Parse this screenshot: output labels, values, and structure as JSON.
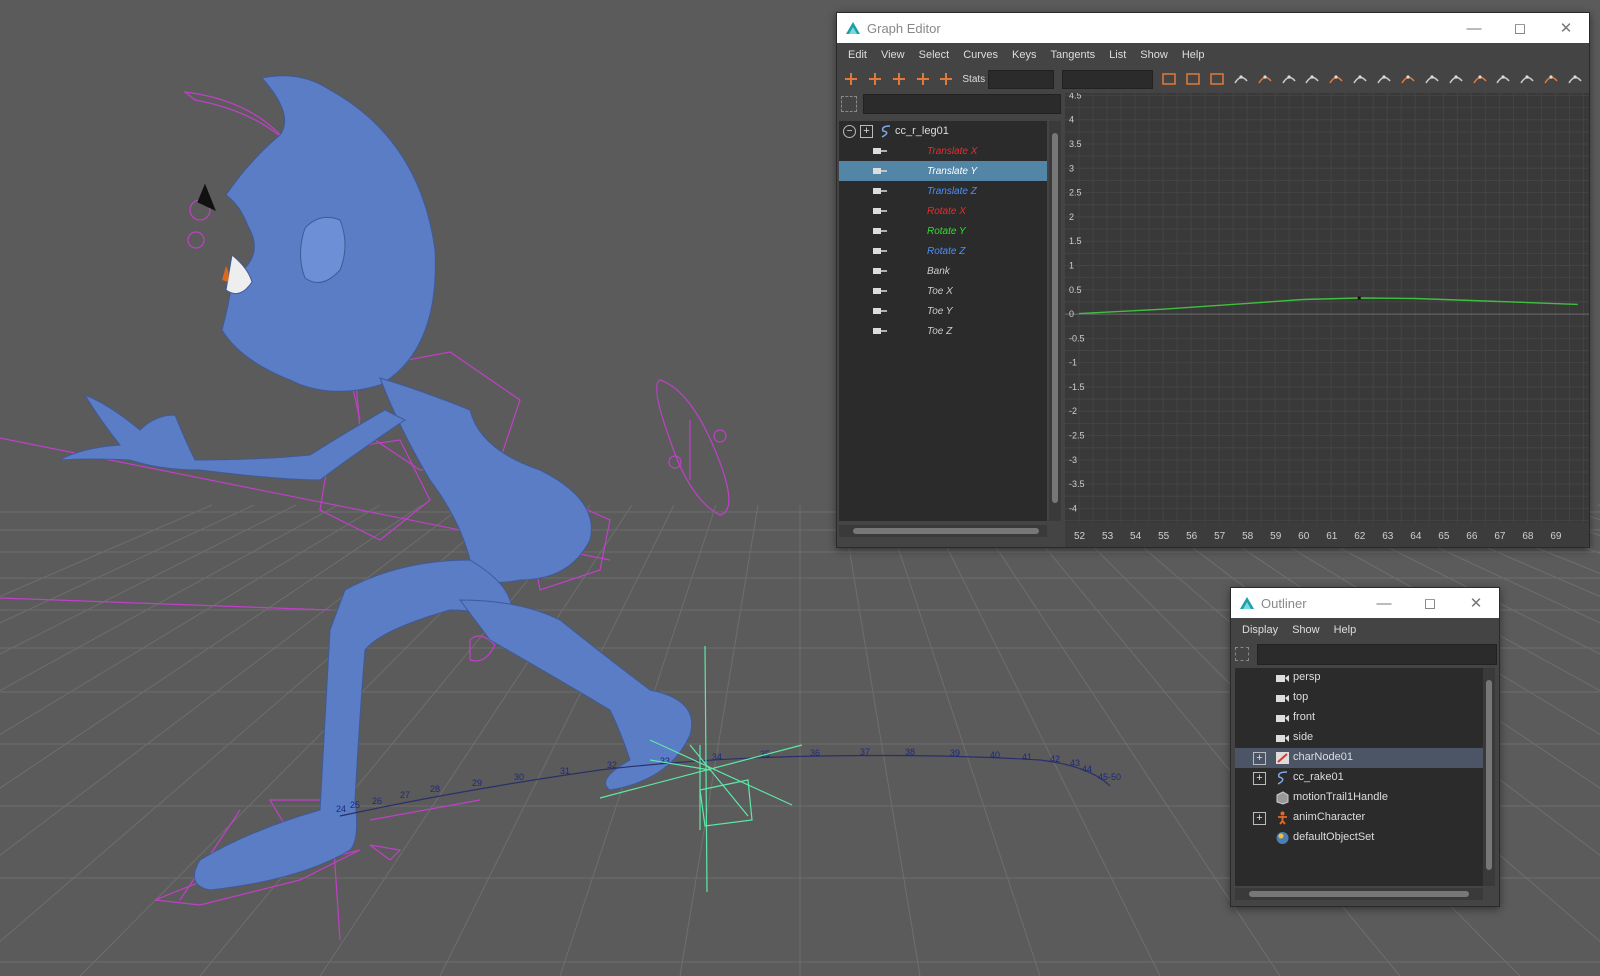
{
  "colors": {
    "viewport_bg": "#5b5b5b",
    "grid": "#6b6b6b",
    "character": "#5a7dc5",
    "rig": "#c040c8",
    "trail": "#2a2f6a",
    "manipulator": "#5ee8a8",
    "curve": "#3fbf3f",
    "selection": "#5285a6",
    "channel_red": "#e03030",
    "channel_green": "#33dd33",
    "channel_blue": "#4a8fff"
  },
  "viewport": {
    "motion_trail_frames": [
      "24",
      "25",
      "26",
      "27",
      "28",
      "29",
      "30",
      "31",
      "32",
      "33",
      "34",
      "35",
      "36",
      "37",
      "38",
      "39",
      "40",
      "41",
      "42",
      "43",
      "44",
      "45-50"
    ]
  },
  "graph_editor": {
    "title": "Graph Editor",
    "menu": [
      "Edit",
      "View",
      "Select",
      "Curves",
      "Keys",
      "Tangents",
      "List",
      "Show",
      "Help"
    ],
    "stats_label": "Stats",
    "node": "cc_r_leg01",
    "channels": [
      {
        "label": "Translate X",
        "color": "red",
        "selected": false
      },
      {
        "label": "Translate Y",
        "color": "white",
        "selected": true
      },
      {
        "label": "Translate Z",
        "color": "blue",
        "selected": false
      },
      {
        "label": "Rotate X",
        "color": "red",
        "selected": false
      },
      {
        "label": "Rotate Y",
        "color": "green",
        "selected": false
      },
      {
        "label": "Rotate Z",
        "color": "blue",
        "selected": false
      },
      {
        "label": "Bank",
        "color": "gray",
        "selected": false
      },
      {
        "label": "Toe X",
        "color": "gray",
        "selected": false
      },
      {
        "label": "Toe Y",
        "color": "gray",
        "selected": false
      },
      {
        "label": "Toe Z",
        "color": "gray",
        "selected": false
      }
    ],
    "toolbar_icons": [
      "move-key-icon",
      "insert-key-icon",
      "lattice-deform-icon",
      "region-select-icon",
      "retime-icon",
      "frame-all-icon",
      "frame-playback-icon",
      "center-current-icon",
      "auto-tangent-icon",
      "spline-tangent-icon",
      "clamped-tangent-icon",
      "linear-tangent-icon",
      "flat-tangent-icon",
      "step-tangent-icon",
      "plateau-tangent-icon",
      "break-tangents-icon",
      "unify-tangents-icon",
      "free-weight-icon",
      "lock-weight-icon",
      "buffer-curve-icon",
      "swap-buffer-icon",
      "dope-sheet-icon",
      "trax-editor-icon"
    ]
  },
  "chart_data": {
    "type": "line",
    "x": [
      52,
      55,
      58,
      60,
      62,
      64,
      66,
      69.8
    ],
    "y": [
      0.01,
      0.1,
      0.22,
      0.3,
      0.33,
      0.32,
      0.28,
      0.2
    ],
    "xticks": [
      "52",
      "53",
      "54",
      "55",
      "56",
      "57",
      "58",
      "59",
      "60",
      "61",
      "62",
      "63",
      "64",
      "65",
      "66",
      "67",
      "68",
      "69"
    ],
    "yticks": [
      "4.5",
      "4",
      "3.5",
      "3",
      "2.5",
      "2",
      "1.5",
      "1",
      "0.5",
      "0",
      "-0.5",
      "-1",
      "-1.5",
      "-2",
      "-2.5",
      "-3",
      "-3.5",
      "-4"
    ],
    "xlim": [
      51.5,
      70.2
    ],
    "ylim": [
      -4.3,
      4.55
    ],
    "key_x": 62,
    "key_y": 0.33,
    "grid": true
  },
  "outliner": {
    "title": "Outliner",
    "menu": [
      "Display",
      "Show",
      "Help"
    ],
    "items": [
      {
        "label": "persp",
        "icon": "camera-icon",
        "expandable": false,
        "selected": false
      },
      {
        "label": "top",
        "icon": "camera-icon",
        "expandable": false,
        "selected": false
      },
      {
        "label": "front",
        "icon": "camera-icon",
        "expandable": false,
        "selected": false
      },
      {
        "label": "side",
        "icon": "camera-icon",
        "expandable": false,
        "selected": false
      },
      {
        "label": "charNode01",
        "icon": "character-node-icon",
        "expandable": true,
        "selected": true
      },
      {
        "label": "cc_rake01",
        "icon": "curve-icon",
        "expandable": true,
        "selected": false
      },
      {
        "label": "motionTrail1Handle",
        "icon": "cube-icon",
        "expandable": false,
        "selected": false
      },
      {
        "label": "animCharacter",
        "icon": "person-icon",
        "expandable": true,
        "selected": false
      },
      {
        "label": "defaultObjectSet",
        "icon": "set-icon",
        "expandable": false,
        "selected": false
      }
    ]
  }
}
